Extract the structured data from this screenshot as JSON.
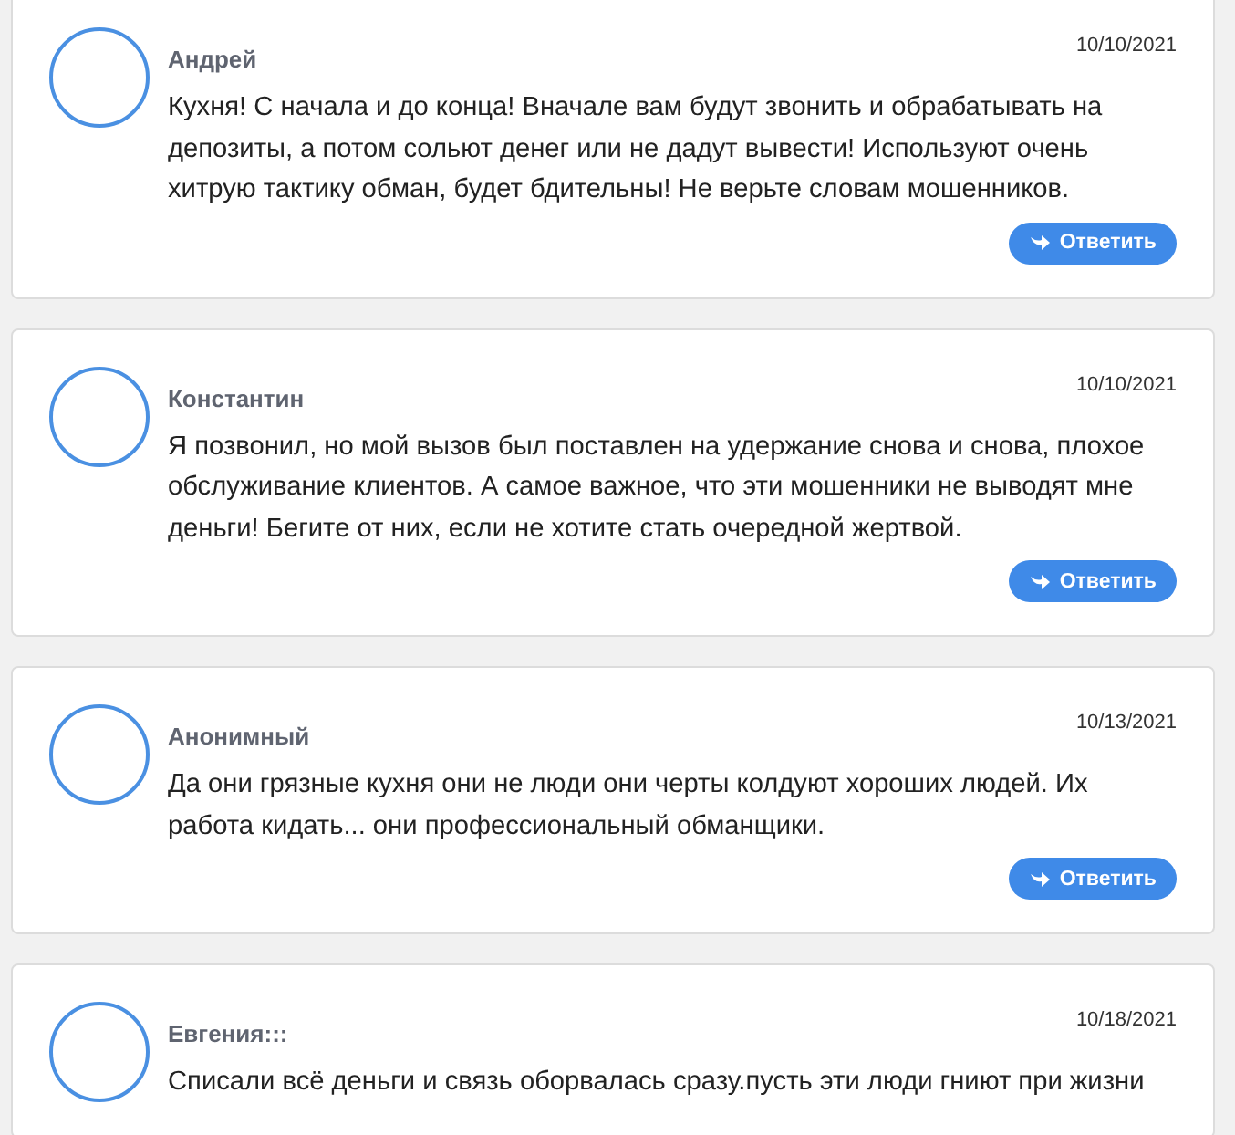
{
  "comments": [
    {
      "author": "Андрей",
      "date": "10/10/2021",
      "text": "Кухня! С начала и до конца! Вначале вам будут звонить и обрабатывать на депозиты, а потом сольют денег или не дадут вывести! Используют очень хитрую тактику обман, будет бдительны! Не верьте словам мошенников.",
      "reply_button": "Ответить"
    },
    {
      "author": "Константин",
      "date": "10/10/2021",
      "text": "Я позвонил, но мой вызов был поставлен на удержание снова и снова, плохое обслуживание клиентов. А самое важное, что эти мошенники не выводят мне деньги! Бегите от них, если не хотите стать очередной жертвой.",
      "reply_button": "Ответить"
    },
    {
      "author": "Анонимный",
      "date": "10/13/2021",
      "text": "Да они грязные кухня они не люди они черты колдуют хороших людей. Их работа кидать... они профессиональный обманщики.",
      "reply_button": "Ответить"
    },
    {
      "author": "Евгения:::",
      "date": "10/18/2021",
      "text": "Списали всё деньги и связь оборвалась сразу.пусть эти люди гниют при жизни"
    }
  ]
}
